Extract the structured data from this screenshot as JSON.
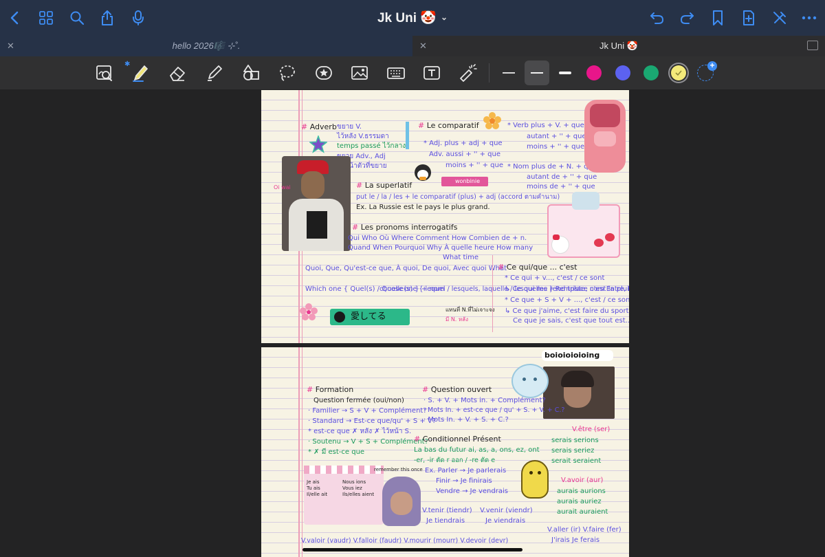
{
  "window": {
    "title": "Jk Uni 🤡"
  },
  "tabs": [
    {
      "label": "hello 2026🎼 ⊹˚."
    },
    {
      "label": "Jk Uni 🤡"
    }
  ],
  "toolbar": {
    "colors": [
      "#e8168a",
      "#5c62f0",
      "#1aa872",
      "#f3ea7a"
    ],
    "accent": "#3e8cf2"
  },
  "page1": {
    "adverb_head": "Adverb",
    "adverb_lines": [
      "ขยาย V.",
      "ไว้หลัง V.ธรรมดา",
      "temps passé ไว้กลาง",
      "ขยาย Adv., Adj",
      "ไว้หน้าตัวที่ขยาย"
    ],
    "comparatif_head": "Le comparatif",
    "adj_lines": [
      "* Adj.  plus + adj + que",
      "Adv.  aussi + '' + que",
      "moins + '' + que"
    ],
    "verb_lines": [
      "* Verb  plus + V. + que",
      "autant + '' + que",
      "moins + '' + que"
    ],
    "nom_lines": [
      "* Nom  plus de + N. + que",
      "autant de + '' + que",
      "moins de + '' + que"
    ],
    "superlatif_head": "La superlatif",
    "superlatif_rule": "put  le / la / les + le comparatif (plus) + adj  (accord ตามคำนาม)",
    "superlatif_ex": "Ex. La Russie est le pays  le plus grand.",
    "pronoms_head": "Les pronoms interrogatifs",
    "pronoms_row1": "Qui Who     Où Where     Comment How     Combien de + n.",
    "pronoms_row2": "Quand When     Pourquoi Why  À quelle heure     How many",
    "pronoms_row3": "What time",
    "quoi_line": "Quoi, Que, Qu'est-ce que, À quoi, De quoi, Avec quoi  What",
    "which_line": "Which one { Quel(s) / Quelle(s) } + nom",
    "lequel_line": "choose one { lequel / lesquels, laquelle / lesquelles }  Remplace nom  Entre, Parmi",
    "cequi_head": "Ce qui/que ... c'est",
    "cequi_lines": [
      "* Ce qui + v..., c'est / ce sont",
      "↳ Ce qui me rend triste, c'est la pluie.",
      "* Ce que + S + V + ..., c'est / ce sont",
      "↳ Ce que j'aime, c'est faire du sport.",
      "Ce que je sais, c'est que tout est.."
    ],
    "wonbinie": "wonbinie",
    "aishiteru": "愛してる",
    "thai_note": "แทนที่ N.ที่ไม่เจาะจง",
    "thai_note2": "มี N. หลัง"
  },
  "page2": {
    "sticker_label": "boioioioioing",
    "formation_head": "Formation",
    "formation_lines": [
      "Question fermée (oui/non)",
      "· Familier → S + V + Complément?",
      "· Standard → Est-ce que/qu' + S + V?",
      "* est-ce que ✗ หลัง ✗ ไว้หน้า S.",
      "· Soutenu → V + S + Complément?",
      "* ✗ มี est-ce que"
    ],
    "ouvert_head": "Question ouvert",
    "ouvert_lines": [
      "· S. + V. + Mots in. + Complément?",
      "· Mots In. + est-ce que / qu' + S. + V. + C.?",
      "· Mots In. + V. + S. + C.?"
    ],
    "cond_head": "Conditionnel Présent",
    "cond_lines": [
      "La bas du futur  ai, as, a, ons, ez, ont",
      "-er, -ir  ตัด r ออก / -re ตัด e",
      "Ex. Parler → Je parlerais",
      "Finir → Je finirais",
      "Vendre → Je vendrais"
    ],
    "etre": [
      "V.être (ser)",
      "serais   serions",
      "serais   seriez",
      "serait   seraient"
    ],
    "avoir": [
      "V.avoir (aur)",
      "aurais   aurions",
      "aurais   auriez",
      "aurait   auraient"
    ],
    "tenir": [
      "V.tenir (tiendr)",
      "Je tiendrais"
    ],
    "venir": [
      "V.venir (viendr)",
      "Je viendrais"
    ],
    "aller_faire": [
      "V.aller (ir)  V.faire (fer)",
      "J'irais   Je ferais"
    ],
    "bottom_row": "V.valoir (vaudr)  V.falloir (faudr)   V.mourir (mourr)   V.devoir (devr)",
    "pronouns": [
      "Je  ais",
      "Tu  ais",
      "Il/elle  ait",
      "Nous  ions",
      "Vous  iez",
      "Ils/elles  aient"
    ],
    "remember": "remember this once"
  }
}
